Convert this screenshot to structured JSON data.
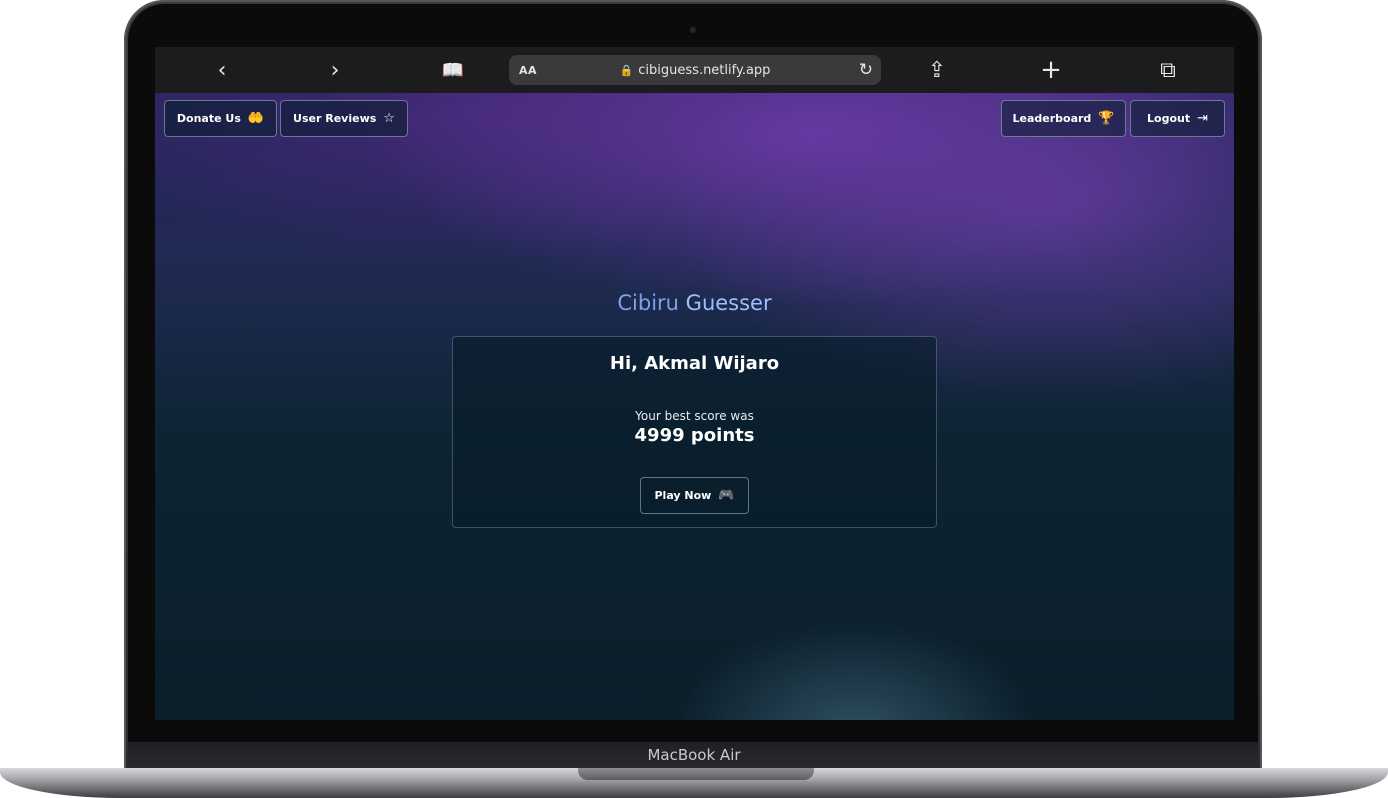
{
  "browser": {
    "back_icon": "chevron-left-icon",
    "back_glyph": "‹",
    "forward_icon": "chevron-right-icon",
    "forward_glyph": "›",
    "bookmarks_icon": "book-icon",
    "bookmarks_glyph": "📖",
    "text_size_label": "AA",
    "url": "cibiguess.netlify.app",
    "lock_glyph": "🔒",
    "reload_glyph": "↻",
    "share_glyph": "⇪",
    "new_tab_glyph": "+",
    "tabs_glyph": "⧉"
  },
  "nav": {
    "donate_label": "Donate Us",
    "donate_glyph": "🤲",
    "reviews_label": "User Reviews",
    "reviews_glyph": "☆",
    "leaderboard_label": "Leaderboard",
    "leaderboard_glyph": "🏆",
    "logout_label": "Logout",
    "logout_glyph": "⇥"
  },
  "main": {
    "title_part1": "Cibiru",
    "title_part2": "Guesser",
    "greeting": "Hi, Akmal Wijaro",
    "score_label": "Your best score was",
    "score_value": "4999 points",
    "play_label": "Play Now",
    "play_glyph": "🎮"
  },
  "device": {
    "label": "MacBook Air"
  },
  "colors": {
    "title_accent": "#9cc0ff",
    "button_border": "#aabed2",
    "toolbar_bg": "#1c1c1e"
  }
}
